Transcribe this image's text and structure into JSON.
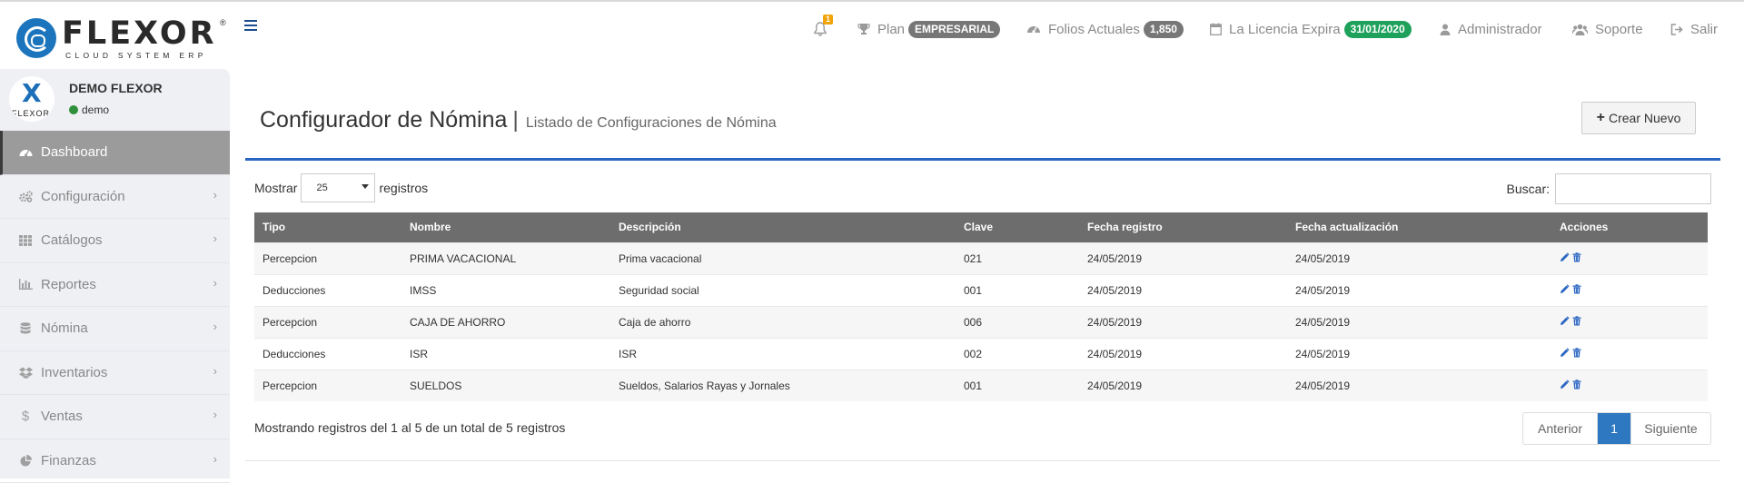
{
  "brand": {
    "name": "FLEXOR",
    "tagline": "CLOUD SYSTEM ERP",
    "registered": "®"
  },
  "header": {
    "notifications_count": "1",
    "plan_label": "Plan",
    "plan_value": "EMPRESARIAL",
    "folios_label": "Folios Actuales",
    "folios_value": "1,850",
    "license_label": "La Licencia Expira",
    "license_value": "31/01/2020",
    "admin_label": "Administrador",
    "support_label": "Soporte",
    "logout_label": "Salir"
  },
  "sidebar": {
    "user_name": "DEMO FLEXOR",
    "user_status": "demo",
    "avatar_mark": "X",
    "avatar_text": "FLEXOR",
    "items": [
      {
        "label": "Dashboard",
        "icon": "dashboard-icon",
        "active": true
      },
      {
        "label": "Configuración",
        "icon": "cogs-icon"
      },
      {
        "label": "Catálogos",
        "icon": "grid-icon"
      },
      {
        "label": "Reportes",
        "icon": "bar-chart-icon"
      },
      {
        "label": "Nómina",
        "icon": "database-icon"
      },
      {
        "label": "Inventarios",
        "icon": "dropbox-icon"
      },
      {
        "label": "Ventas",
        "icon": "dollar-icon"
      },
      {
        "label": "Finanzas",
        "icon": "pie-chart-icon"
      }
    ]
  },
  "page": {
    "title": "Configurador de Nómina",
    "separator": "|",
    "subtitle": "Listado de Configuraciones de Nómina",
    "new_button": "Crear Nuevo"
  },
  "table_controls": {
    "show_label": "Mostrar",
    "page_size": "25",
    "records_label": "registros",
    "search_label": "Buscar:",
    "search_value": ""
  },
  "table": {
    "columns": [
      "Tipo",
      "Nombre",
      "Descripción",
      "Clave",
      "Fecha registro",
      "Fecha actualización",
      "Acciones"
    ],
    "rows": [
      [
        "Percepcion",
        "PRIMA VACACIONAL",
        "Prima vacacional",
        "021",
        "24/05/2019",
        "24/05/2019"
      ],
      [
        "Deducciones",
        "IMSS",
        "Seguridad social",
        "001",
        "24/05/2019",
        "24/05/2019"
      ],
      [
        "Percepcion",
        "CAJA DE AHORRO",
        "Caja de ahorro",
        "006",
        "24/05/2019",
        "24/05/2019"
      ],
      [
        "Deducciones",
        "ISR",
        "ISR",
        "002",
        "24/05/2019",
        "24/05/2019"
      ],
      [
        "Percepcion",
        "SUELDOS",
        "Sueldos, Salarios Rayas y Jornales",
        "001",
        "24/05/2019",
        "24/05/2019"
      ]
    ]
  },
  "footer": {
    "info": "Mostrando registros del 1 al 5 de un total de 5 registros",
    "prev": "Anterior",
    "current_page": "1",
    "next": "Siguiente"
  },
  "colors": {
    "accent": "#2b66c2",
    "header_row": "#6d6d6d",
    "pager_active": "#2d78c0",
    "badge_green": "#1ea15b",
    "badge_gray": "#777777"
  }
}
